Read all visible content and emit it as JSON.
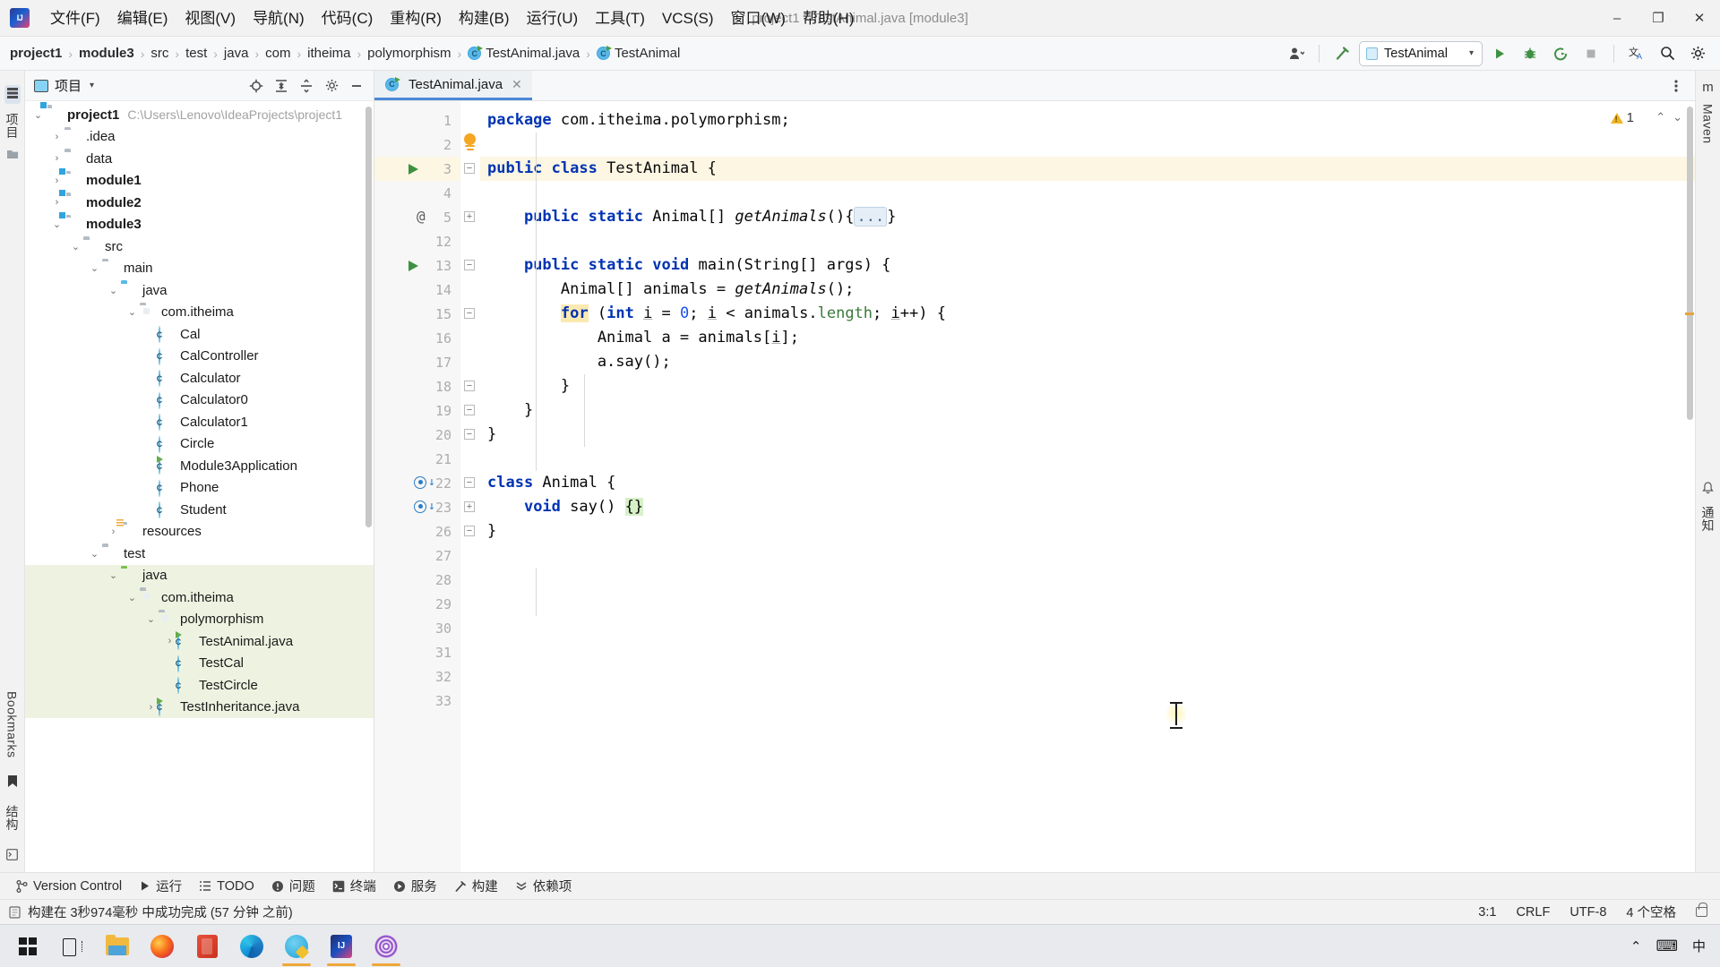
{
  "window": {
    "title": "project1 - TestAnimal.java [module3]",
    "minimize": "–",
    "maximize": "❐",
    "close": "✕"
  },
  "menubar": {
    "items": [
      {
        "label": "文件(F)"
      },
      {
        "label": "编辑(E)"
      },
      {
        "label": "视图(V)"
      },
      {
        "label": "导航(N)"
      },
      {
        "label": "代码(C)"
      },
      {
        "label": "重构(R)"
      },
      {
        "label": "构建(B)"
      },
      {
        "label": "运行(U)"
      },
      {
        "label": "工具(T)"
      },
      {
        "label": "VCS(S)"
      },
      {
        "label": "窗口(W)"
      },
      {
        "label": "帮助(H)"
      }
    ]
  },
  "breadcrumb": {
    "items": [
      {
        "label": "project1",
        "bold": true,
        "icon": ""
      },
      {
        "label": "module3",
        "bold": true,
        "icon": ""
      },
      {
        "label": "src",
        "bold": false,
        "icon": ""
      },
      {
        "label": "test",
        "bold": false,
        "icon": ""
      },
      {
        "label": "java",
        "bold": false,
        "icon": ""
      },
      {
        "label": "com",
        "bold": false,
        "icon": ""
      },
      {
        "label": "itheima",
        "bold": false,
        "icon": ""
      },
      {
        "label": "polymorphism",
        "bold": false,
        "icon": ""
      },
      {
        "label": "TestAnimal.java",
        "bold": false,
        "icon": "java-class-icon"
      },
      {
        "label": "TestAnimal",
        "bold": false,
        "icon": "java-class-icon"
      }
    ],
    "separator": "›"
  },
  "toolbar": {
    "profile_icon": "user-profile-icon",
    "build_icon": "build-hammer-icon",
    "run_config_name": "TestAnimal",
    "run_icon": "run-play-icon",
    "debug_icon": "debug-bug-icon",
    "coverage_icon": "run-with-coverage-icon",
    "stop_icon": "stop-icon",
    "translate_icon": "translate-icon",
    "search_icon": "search-icon",
    "settings_icon": "settings-gear-icon",
    "dropdown_caret": "▾"
  },
  "left_strip": {
    "project_label": "项目",
    "bookmarks_label": "Bookmarks",
    "structure_label": "结构"
  },
  "right_strip": {
    "maven_label": "Maven",
    "notifications_label": "通知"
  },
  "project_panel": {
    "title": "项目",
    "caret": "▾",
    "icons": [
      "locate-target-icon",
      "expand-all-icon",
      "collapse-all-icon",
      "settings-gear-icon",
      "hide-panel-icon"
    ],
    "tree": [
      {
        "depth": 0,
        "arrow": "⌄",
        "icon": "folder-module",
        "label": "project1",
        "bold": true,
        "path": "C:\\Users\\Lenovo\\IdeaProjects\\project1",
        "green": false
      },
      {
        "depth": 1,
        "arrow": "›",
        "icon": "folder-plain",
        "label": ".idea",
        "bold": false,
        "path": "",
        "green": false
      },
      {
        "depth": 1,
        "arrow": "›",
        "icon": "folder-plain",
        "label": "data",
        "bold": false,
        "path": "",
        "green": false
      },
      {
        "depth": 1,
        "arrow": "›",
        "icon": "folder-module",
        "label": "module1",
        "bold": true,
        "path": "",
        "green": false
      },
      {
        "depth": 1,
        "arrow": "›",
        "icon": "folder-module",
        "label": "module2",
        "bold": true,
        "path": "",
        "green": false
      },
      {
        "depth": 1,
        "arrow": "⌄",
        "icon": "folder-module",
        "label": "module3",
        "bold": true,
        "path": "",
        "green": false
      },
      {
        "depth": 2,
        "arrow": "⌄",
        "icon": "folder-plain",
        "label": "src",
        "bold": false,
        "path": "",
        "green": false
      },
      {
        "depth": 3,
        "arrow": "⌄",
        "icon": "folder-plain",
        "label": "main",
        "bold": false,
        "path": "",
        "green": false
      },
      {
        "depth": 4,
        "arrow": "⌄",
        "icon": "folder-source",
        "label": "java",
        "bold": false,
        "path": "",
        "green": false
      },
      {
        "depth": 5,
        "arrow": "⌄",
        "icon": "folder-package",
        "label": "com.itheima",
        "bold": false,
        "path": "",
        "green": false
      },
      {
        "depth": 6,
        "arrow": "",
        "icon": "java-class",
        "label": "Cal",
        "bold": false,
        "path": "",
        "green": false
      },
      {
        "depth": 6,
        "arrow": "",
        "icon": "java-class",
        "label": "CalController",
        "bold": false,
        "path": "",
        "green": false
      },
      {
        "depth": 6,
        "arrow": "",
        "icon": "java-class",
        "label": "Calculator",
        "bold": false,
        "path": "",
        "green": false
      },
      {
        "depth": 6,
        "arrow": "",
        "icon": "java-class",
        "label": "Calculator0",
        "bold": false,
        "path": "",
        "green": false
      },
      {
        "depth": 6,
        "arrow": "",
        "icon": "java-class",
        "label": "Calculator1",
        "bold": false,
        "path": "",
        "green": false
      },
      {
        "depth": 6,
        "arrow": "",
        "icon": "java-class",
        "label": "Circle",
        "bold": false,
        "path": "",
        "green": false
      },
      {
        "depth": 6,
        "arrow": "",
        "icon": "java-class-runnable",
        "label": "Module3Application",
        "bold": false,
        "path": "",
        "green": false
      },
      {
        "depth": 6,
        "arrow": "",
        "icon": "java-class",
        "label": "Phone",
        "bold": false,
        "path": "",
        "green": false
      },
      {
        "depth": 6,
        "arrow": "",
        "icon": "java-class",
        "label": "Student",
        "bold": false,
        "path": "",
        "green": false
      },
      {
        "depth": 4,
        "arrow": "›",
        "icon": "folder-resources",
        "label": "resources",
        "bold": false,
        "path": "",
        "green": false
      },
      {
        "depth": 3,
        "arrow": "⌄",
        "icon": "folder-plain",
        "label": "test",
        "bold": false,
        "path": "",
        "green": false
      },
      {
        "depth": 4,
        "arrow": "⌄",
        "icon": "folder-test-source",
        "label": "java",
        "bold": false,
        "path": "",
        "green": true
      },
      {
        "depth": 5,
        "arrow": "⌄",
        "icon": "folder-package",
        "label": "com.itheima",
        "bold": false,
        "path": "",
        "green": true
      },
      {
        "depth": 6,
        "arrow": "⌄",
        "icon": "folder-package",
        "label": "polymorphism",
        "bold": false,
        "path": "",
        "green": true
      },
      {
        "depth": 7,
        "arrow": "›",
        "icon": "java-class-runnable",
        "label": "TestAnimal.java",
        "bold": false,
        "path": "",
        "green": true
      },
      {
        "depth": 7,
        "arrow": "",
        "icon": "java-class",
        "label": "TestCal",
        "bold": false,
        "path": "",
        "green": true
      },
      {
        "depth": 7,
        "arrow": "",
        "icon": "java-class",
        "label": "TestCircle",
        "bold": false,
        "path": "",
        "green": true
      },
      {
        "depth": 6,
        "arrow": "›",
        "icon": "java-class-runnable",
        "label": "TestInheritance.java",
        "bold": false,
        "path": "",
        "green": true
      }
    ]
  },
  "editor": {
    "tab": {
      "label": "TestAnimal.java",
      "icon": "java-class-icon",
      "close": "✕"
    },
    "tab_options_icon": "more-options-icon",
    "warning_count": "1",
    "warning_icon": "warning-triangle-icon",
    "prev_highlight_icon": "⌃",
    "next_highlight_icon": "⌄",
    "bulb_icon": "intention-bulb-icon",
    "lines": [
      {
        "num": "1",
        "gutter": "",
        "fold": "",
        "highlight": false,
        "html": "<span class=\"kw\">package</span> com.itheima.polymorphism;"
      },
      {
        "num": "2",
        "gutter": "",
        "fold": "",
        "highlight": false,
        "html": ""
      },
      {
        "num": "3",
        "gutter": "run",
        "fold": "open",
        "highlight": true,
        "html": "<span class=\"kw\">public</span> <span class=\"kw\">class</span> TestAnimal {"
      },
      {
        "num": "4",
        "gutter": "",
        "fold": "",
        "highlight": false,
        "html": ""
      },
      {
        "num": "5",
        "gutter": "at",
        "fold": "plus",
        "highlight": false,
        "html": "    <span class=\"kw\">public</span> <span class=\"kw\">static</span> Animal[] <span class=\"ital\">getAnimals</span>(){<span class=\"folded\">...</span>}"
      },
      {
        "num": "12",
        "gutter": "",
        "fold": "",
        "highlight": false,
        "html": ""
      },
      {
        "num": "13",
        "gutter": "run",
        "fold": "open",
        "highlight": false,
        "html": "    <span class=\"kw\">public</span> <span class=\"kw\">static</span> <span class=\"kw\">void</span> main(String[] args) {"
      },
      {
        "num": "14",
        "gutter": "",
        "fold": "",
        "highlight": false,
        "html": "        Animal[] animals = <span class=\"ital\">getAnimals</span>();"
      },
      {
        "num": "15",
        "gutter": "",
        "fold": "open",
        "highlight": false,
        "html": "        <span class=\"forhl kw\">for</span> (<span class=\"kw\">int</span> <span class=\"underl\">i</span> = <span class=\"num\">0</span>; <span class=\"underl\">i</span> &lt; animals.<span class=\"fieldm\">length</span>; <span class=\"underl\">i</span>++) {"
      },
      {
        "num": "16",
        "gutter": "",
        "fold": "",
        "highlight": false,
        "html": "            Animal a = animals[<span class=\"underl\">i</span>];"
      },
      {
        "num": "17",
        "gutter": "",
        "fold": "",
        "highlight": false,
        "html": "            a.say();"
      },
      {
        "num": "18",
        "gutter": "",
        "fold": "close",
        "highlight": false,
        "html": "        }"
      },
      {
        "num": "19",
        "gutter": "",
        "fold": "close",
        "highlight": false,
        "html": "    }"
      },
      {
        "num": "20",
        "gutter": "",
        "fold": "close",
        "highlight": false,
        "html": "}"
      },
      {
        "num": "21",
        "gutter": "",
        "fold": "",
        "highlight": false,
        "html": ""
      },
      {
        "num": "22",
        "gutter": "override",
        "fold": "open",
        "highlight": false,
        "html": "<span class=\"kw\">class</span> Animal {"
      },
      {
        "num": "23",
        "gutter": "override",
        "fold": "plus",
        "highlight": false,
        "html": "    <span class=\"kw\">void</span> say() <span class=\"bracehl\">{}</span>"
      },
      {
        "num": "26",
        "gutter": "",
        "fold": "close",
        "highlight": false,
        "html": "}"
      },
      {
        "num": "27",
        "gutter": "",
        "fold": "",
        "highlight": false,
        "html": ""
      },
      {
        "num": "28",
        "gutter": "",
        "fold": "",
        "highlight": false,
        "html": ""
      },
      {
        "num": "29",
        "gutter": "",
        "fold": "",
        "highlight": false,
        "html": ""
      },
      {
        "num": "30",
        "gutter": "",
        "fold": "",
        "highlight": false,
        "html": ""
      },
      {
        "num": "31",
        "gutter": "",
        "fold": "",
        "highlight": false,
        "html": ""
      },
      {
        "num": "32",
        "gutter": "",
        "fold": "",
        "highlight": false,
        "html": ""
      },
      {
        "num": "33",
        "gutter": "",
        "fold": "",
        "highlight": false,
        "html": ""
      }
    ]
  },
  "bottom_toolwindows": [
    {
      "label": "Version Control",
      "icon": "branch-icon"
    },
    {
      "label": "运行",
      "icon": "run-play-icon"
    },
    {
      "label": "TODO",
      "icon": "todo-list-icon"
    },
    {
      "label": "问题",
      "icon": "problems-icon"
    },
    {
      "label": "终端",
      "icon": "terminal-icon"
    },
    {
      "label": "服务",
      "icon": "services-icon"
    },
    {
      "label": "构建",
      "icon": "build-hammer-icon"
    },
    {
      "label": "依赖项",
      "icon": "dependencies-icon"
    }
  ],
  "statusbar": {
    "message": "构建在 3秒974毫秒 中成功完成 (57 分钟 之前)",
    "message_icon": "build-status-icon",
    "caret_position": "3:1",
    "line_separator": "CRLF",
    "encoding": "UTF-8",
    "indent": "4 个空格",
    "lock_icon": "lock-open-icon"
  },
  "taskbar": {
    "items": [
      {
        "name": "start-button",
        "icon": "windows-logo-icon",
        "active": false
      },
      {
        "name": "task-view-button",
        "icon": "task-view-icon",
        "active": false
      },
      {
        "name": "file-explorer",
        "icon": "file-explorer-icon",
        "active": false
      },
      {
        "name": "firefox",
        "icon": "firefox-icon",
        "active": false
      },
      {
        "name": "office",
        "icon": "office-icon",
        "active": false
      },
      {
        "name": "edge",
        "icon": "edge-icon",
        "active": false
      },
      {
        "name": "qq",
        "icon": "qq-icon",
        "active": true
      },
      {
        "name": "intellij-idea",
        "icon": "intellij-idea-icon",
        "active": true
      },
      {
        "name": "tor-browser",
        "icon": "tor-browser-icon",
        "active": true
      }
    ],
    "tray": {
      "chevron": "⌃",
      "keyboard": "⌨",
      "ime": "中"
    }
  },
  "colors": {
    "accent": "#4a88d8",
    "keyword": "#0033b3",
    "number": "#1750eb",
    "test_source_green": "#eef3e1",
    "highlight_line": "#fdf6e3",
    "run_green": "#3f9142"
  }
}
